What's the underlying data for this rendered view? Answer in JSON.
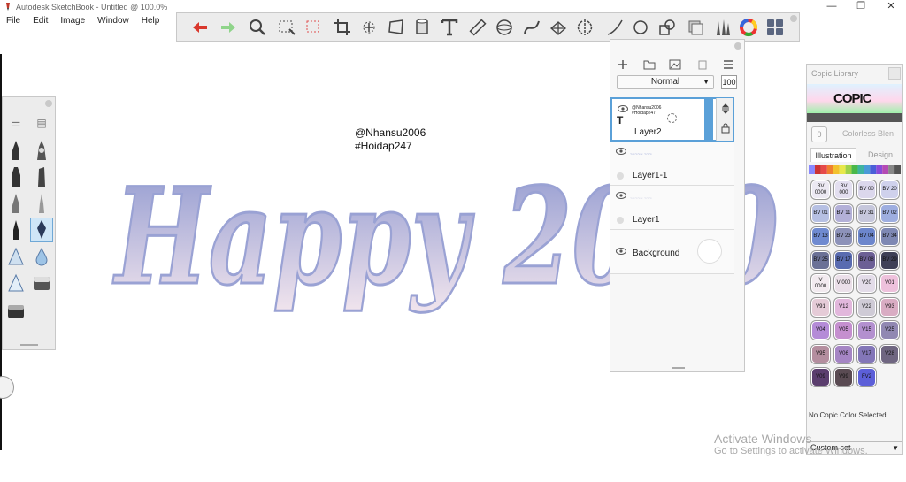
{
  "window": {
    "title": "Autodesk SketchBook - Untitled @ 100.0%",
    "minimize": "—",
    "maximize": "❐",
    "close": "✕"
  },
  "menu": [
    "File",
    "Edit",
    "Image",
    "Window",
    "Help"
  ],
  "toolbar": {
    "tools": [
      "undo-icon",
      "redo-icon",
      "zoom-icon",
      "select-icon",
      "lasso-icon",
      "crop-icon",
      "move-icon",
      "distort-icon",
      "fill-icon",
      "text-icon",
      "ruler-icon",
      "ellipse-guide-icon",
      "french-curve-icon",
      "perspective-icon",
      "symmetry-icon",
      "stroke-icon",
      "shape-icon",
      "copy-icon",
      "layers-icon",
      "brushes-icon",
      "color-wheel-icon",
      "copic-icon"
    ]
  },
  "canvas": {
    "line1": "@Nhansu2006",
    "line2": "#Hoidap247",
    "art_text": "Happy 2020",
    "colors": {
      "art_top": "#8f98cf",
      "art_bottom": "#f3e6ee"
    }
  },
  "layers": {
    "blend_mode": "Normal",
    "opacity": "100",
    "items": [
      {
        "name": "Layer2",
        "thumb1": "@Nhansu2006",
        "thumb2": "#Hoidap247",
        "selected": true
      },
      {
        "name": "Layer1-1",
        "selected": false
      },
      {
        "name": "Layer1",
        "selected": false
      },
      {
        "name": "Background",
        "selected": false
      }
    ]
  },
  "copic": {
    "title": "Copic Library",
    "logo": "COPIC",
    "colorless_chip": "0",
    "colorless_label": "Colorless Blen",
    "tabs": [
      "Illustration",
      "Design"
    ],
    "swatches": [
      {
        "code": "BV 0000",
        "color": "#ece9f3"
      },
      {
        "code": "BV 000",
        "color": "#e3dff0"
      },
      {
        "code": "BV 00",
        "color": "#dbd7ec"
      },
      {
        "code": "BV 20",
        "color": "#cfd1ec"
      },
      {
        "code": "BV 01",
        "color": "#b6c0e3"
      },
      {
        "code": "BV 11",
        "color": "#b3b0d8"
      },
      {
        "code": "BV 31",
        "color": "#c6c7dc"
      },
      {
        "code": "BV 02",
        "color": "#9eaee0"
      },
      {
        "code": "BV 13",
        "color": "#6f8ad0"
      },
      {
        "code": "BV 23",
        "color": "#8d92b9"
      },
      {
        "code": "BV 04",
        "color": "#6c86cc"
      },
      {
        "code": "BV 34",
        "color": "#7e88b3"
      },
      {
        "code": "BV 25",
        "color": "#6b7196"
      },
      {
        "code": "BV 17",
        "color": "#596bb0"
      },
      {
        "code": "BV 08",
        "color": "#6c5f95"
      },
      {
        "code": "BV 29",
        "color": "#3f4057"
      },
      {
        "code": "V 0000",
        "color": "#f2eaef"
      },
      {
        "code": "V 000",
        "color": "#ebdfe9"
      },
      {
        "code": "V20",
        "color": "#e3dce9"
      },
      {
        "code": "V01",
        "color": "#eec1dc"
      },
      {
        "code": "V91",
        "color": "#e5cbd7"
      },
      {
        "code": "V12",
        "color": "#e2b7dc"
      },
      {
        "code": "V22",
        "color": "#cfcbd6"
      },
      {
        "code": "V93",
        "color": "#d9acc3"
      },
      {
        "code": "V04",
        "color": "#b48bd7"
      },
      {
        "code": "V05",
        "color": "#c58fcf"
      },
      {
        "code": "V15",
        "color": "#b390cf"
      },
      {
        "code": "V25",
        "color": "#9188b2"
      },
      {
        "code": "V95",
        "color": "#b48e9f"
      },
      {
        "code": "V06",
        "color": "#a585c4"
      },
      {
        "code": "V17",
        "color": "#8376b8"
      },
      {
        "code": "V28",
        "color": "#6f6681"
      },
      {
        "code": "V09",
        "color": "#5b3e6e"
      },
      {
        "code": "V99",
        "color": "#5a4b53"
      },
      {
        "code": "FV2",
        "color": "#5c5fd8"
      }
    ],
    "strip_colors": [
      "#8888ff",
      "#cc3333",
      "#e64a4a",
      "#f08030",
      "#f2c12e",
      "#e8e84a",
      "#9fd24a",
      "#4ab84a",
      "#3fb4a0",
      "#4a9ad8",
      "#4a5fd8",
      "#8a4ad8",
      "#b44ab4",
      "#888888",
      "#555555"
    ],
    "no_selection": "No Copic Color Selected",
    "custom_set": "Custom set"
  },
  "watermark": {
    "line1": "Activate Windows",
    "line2": "Go to Settings to activate Windows."
  }
}
